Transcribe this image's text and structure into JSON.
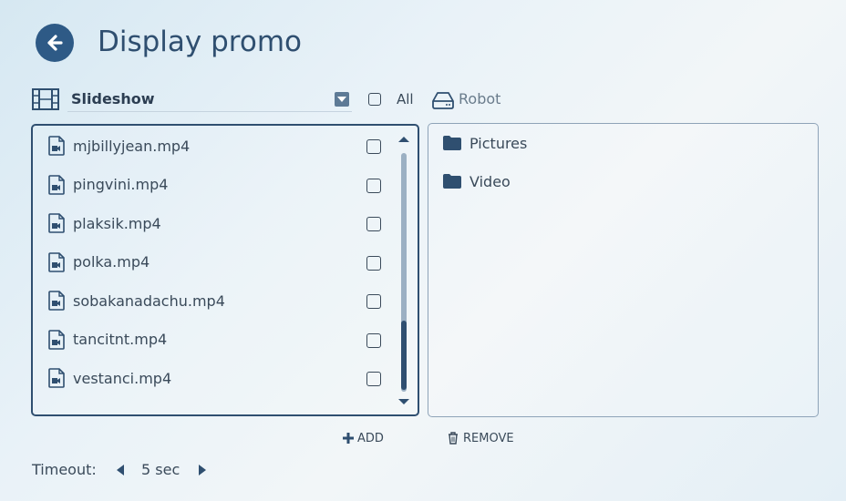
{
  "header": {
    "title": "Display promo",
    "back_icon": "arrow-left-circle-icon"
  },
  "toolbar": {
    "source_icon": "film-strip-icon",
    "source_selected": "Slideshow",
    "all_label": "All",
    "all_checked": false,
    "robot_icon": "drive-icon",
    "robot_label": "Robot"
  },
  "files": [
    {
      "name": "mjbillyjean.mp4",
      "icon": "video-file-icon",
      "checked": false
    },
    {
      "name": "pingvini.mp4",
      "icon": "video-file-icon",
      "checked": false
    },
    {
      "name": "plaksik.mp4",
      "icon": "video-file-icon",
      "checked": false
    },
    {
      "name": "polka.mp4",
      "icon": "video-file-icon",
      "checked": false
    },
    {
      "name": "sobakanadachu.mp4",
      "icon": "video-file-icon",
      "checked": false
    },
    {
      "name": "tancitnt.mp4",
      "icon": "video-file-icon",
      "checked": false
    },
    {
      "name": "vestanci.mp4",
      "icon": "video-file-icon",
      "checked": false
    }
  ],
  "folders": [
    {
      "name": "Pictures",
      "icon": "folder-icon"
    },
    {
      "name": "Video",
      "icon": "folder-icon"
    }
  ],
  "actions": {
    "add_label": "ADD",
    "remove_label": "REMOVE"
  },
  "timeout": {
    "label": "Timeout:",
    "value": "5 sec"
  },
  "colors": {
    "accent": "#2f4f70",
    "border_light": "#8ea3b8",
    "scroll_track": "#9bb0c3"
  }
}
